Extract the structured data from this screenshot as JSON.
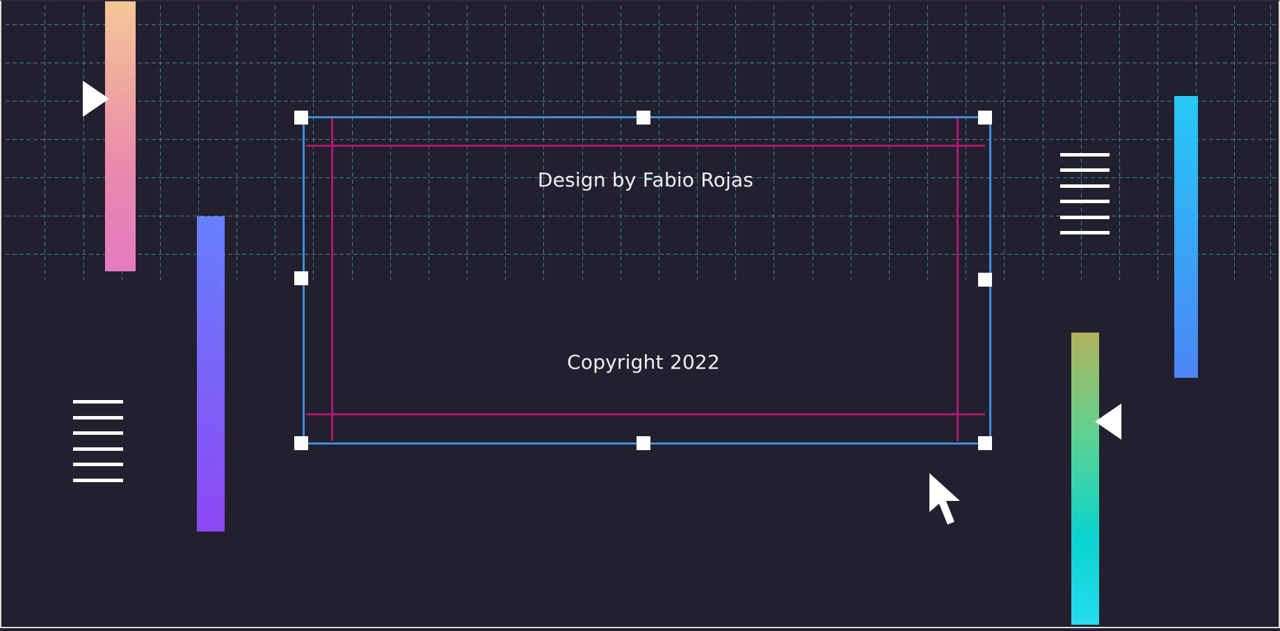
{
  "canvas": {
    "background": "#221f2f",
    "grid_color": "#46aab4"
  },
  "footer_text_box": {
    "design_credit": "Design by Fabio Rojas",
    "copyright": "Copyright 2022",
    "selection_color": "#3b8fe6",
    "guide_color": "#b0186f"
  },
  "decorations": {
    "gradient_bars": [
      {
        "name": "peach-pink",
        "from": "#f4c896",
        "to": "#e47ac0"
      },
      {
        "name": "blue-violet",
        "from": "#6680fc",
        "to": "#8d48f4"
      },
      {
        "name": "cyan-blue",
        "from": "#25c9f6",
        "to": "#4c86f5"
      },
      {
        "name": "olive-cyan",
        "from": "#b0b25c",
        "to": "#26dcef"
      }
    ],
    "icons": [
      "play-right-icon",
      "play-left-icon",
      "lines-icon",
      "cursor-arrow-icon"
    ]
  }
}
